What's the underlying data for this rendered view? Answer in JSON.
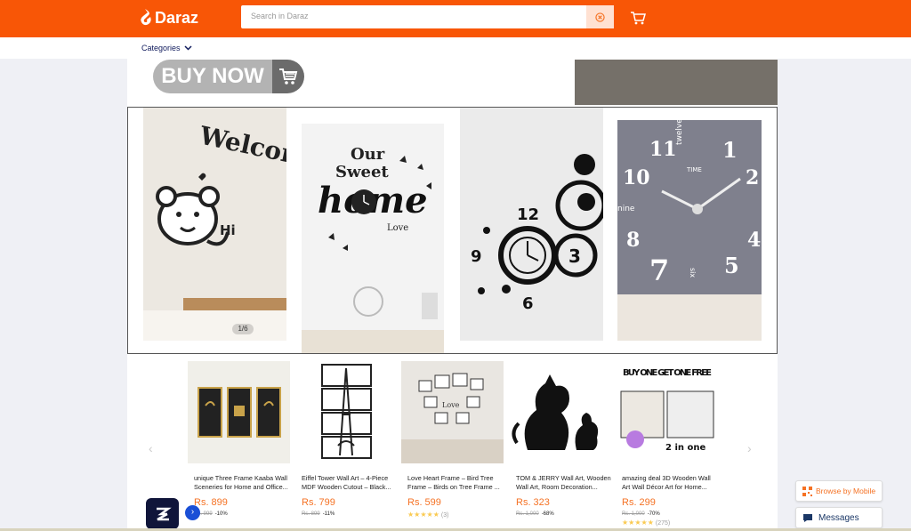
{
  "header": {
    "brand": "Daraz",
    "search_placeholder": "Search in Daraz",
    "categories_label": "Categories"
  },
  "promo": {
    "buy_now_label": "BUY NOW"
  },
  "banner": {
    "slide_counter": "1/6",
    "slide_texts": {
      "welcome": "Welcome!",
      "hi": "Hi",
      "our": "Our",
      "sweet": "Sweet",
      "home": "home",
      "love": "Love",
      "clock_numbers": [
        "12",
        "3",
        "6",
        "9"
      ],
      "wall_clock_numbers": [
        "11",
        "1",
        "10",
        "2",
        "8",
        "4",
        "7",
        "5"
      ],
      "time": "TIME",
      "twelve": "twelve",
      "nine": "nine",
      "six": "six"
    }
  },
  "products": [
    {
      "title": "unique Three Frame Kaaba Wall Sceneries for Home and Office...",
      "price": "Rs. 899",
      "old_price": "Rs. 999",
      "discount": "-10%",
      "rating": "",
      "rating_count": ""
    },
    {
      "title": "Eiffel Tower Wall Art – 4-Piece MDF Wooden Cutout – Black...",
      "price": "Rs. 799",
      "old_price": "Rs. 899",
      "discount": "-11%",
      "rating": "",
      "rating_count": ""
    },
    {
      "title": "Love Heart Frame – Bird Tree Frame – Birds on Tree Frame ...",
      "price": "Rs. 599",
      "old_price": "",
      "discount": "",
      "rating": "★★★★★",
      "rating_count": "(3)"
    },
    {
      "title": "TOM & JERRY Wall Art, Wooden Wall Art, Room Decoration...",
      "price": "Rs. 323",
      "old_price": "Rs. 1,000",
      "discount": "-68%",
      "rating": "",
      "rating_count": ""
    },
    {
      "title": "amazing deal 3D Wooden Wall Art Wall Décor Art for Home...",
      "price": "Rs. 299",
      "old_price": "Rs. 1,000",
      "discount": "-70%",
      "rating": "★★★★★",
      "rating_count": "(275)"
    }
  ],
  "product_overlays": {
    "buy_one": "BUY ONE GET ONE FREE",
    "two_in_one": "2 in one",
    "love": "Love"
  },
  "widgets": {
    "browse_label": "Browse by Mobile",
    "messages_label": "Messages"
  },
  "colors": {
    "brand_orange": "#f85606",
    "price_orange": "#f57224",
    "navy": "#0f1a5c"
  }
}
